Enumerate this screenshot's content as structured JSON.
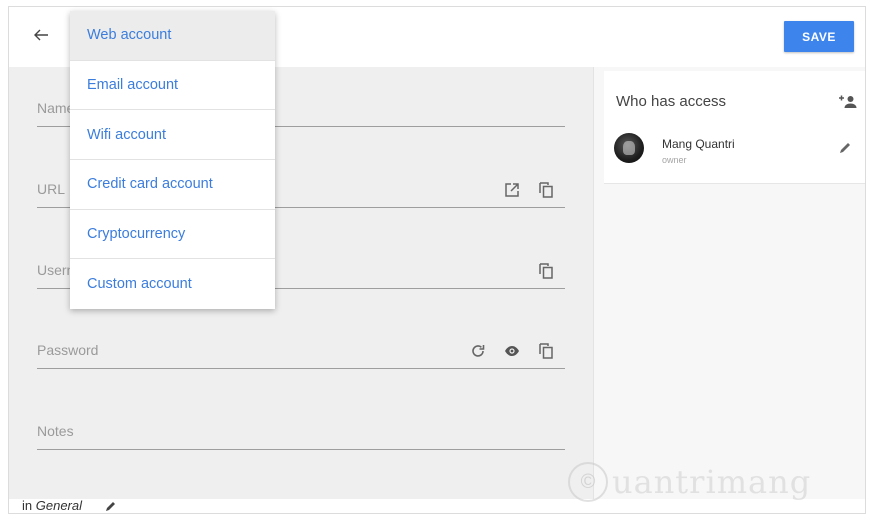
{
  "header": {
    "back_icon": "arrow-left-icon",
    "save_label": "SAVE",
    "accent": "#3d84ec"
  },
  "account_type_menu": {
    "selected": "Web account",
    "options": [
      "Web account",
      "Email account",
      "Wifi account",
      "Credit card account",
      "Cryptocurrency",
      "Custom account"
    ]
  },
  "form": {
    "name_label": "Name",
    "url_label": "URL",
    "username_label": "Username",
    "password_label": "Password",
    "notes_label": "Notes"
  },
  "access": {
    "title": "Who has access",
    "users": [
      {
        "name": "Mang Quantri",
        "role": "owner"
      }
    ]
  },
  "footer": {
    "prefix": "in",
    "group": "General"
  },
  "watermark": {
    "text": "uantrimang",
    "mark": "©"
  }
}
